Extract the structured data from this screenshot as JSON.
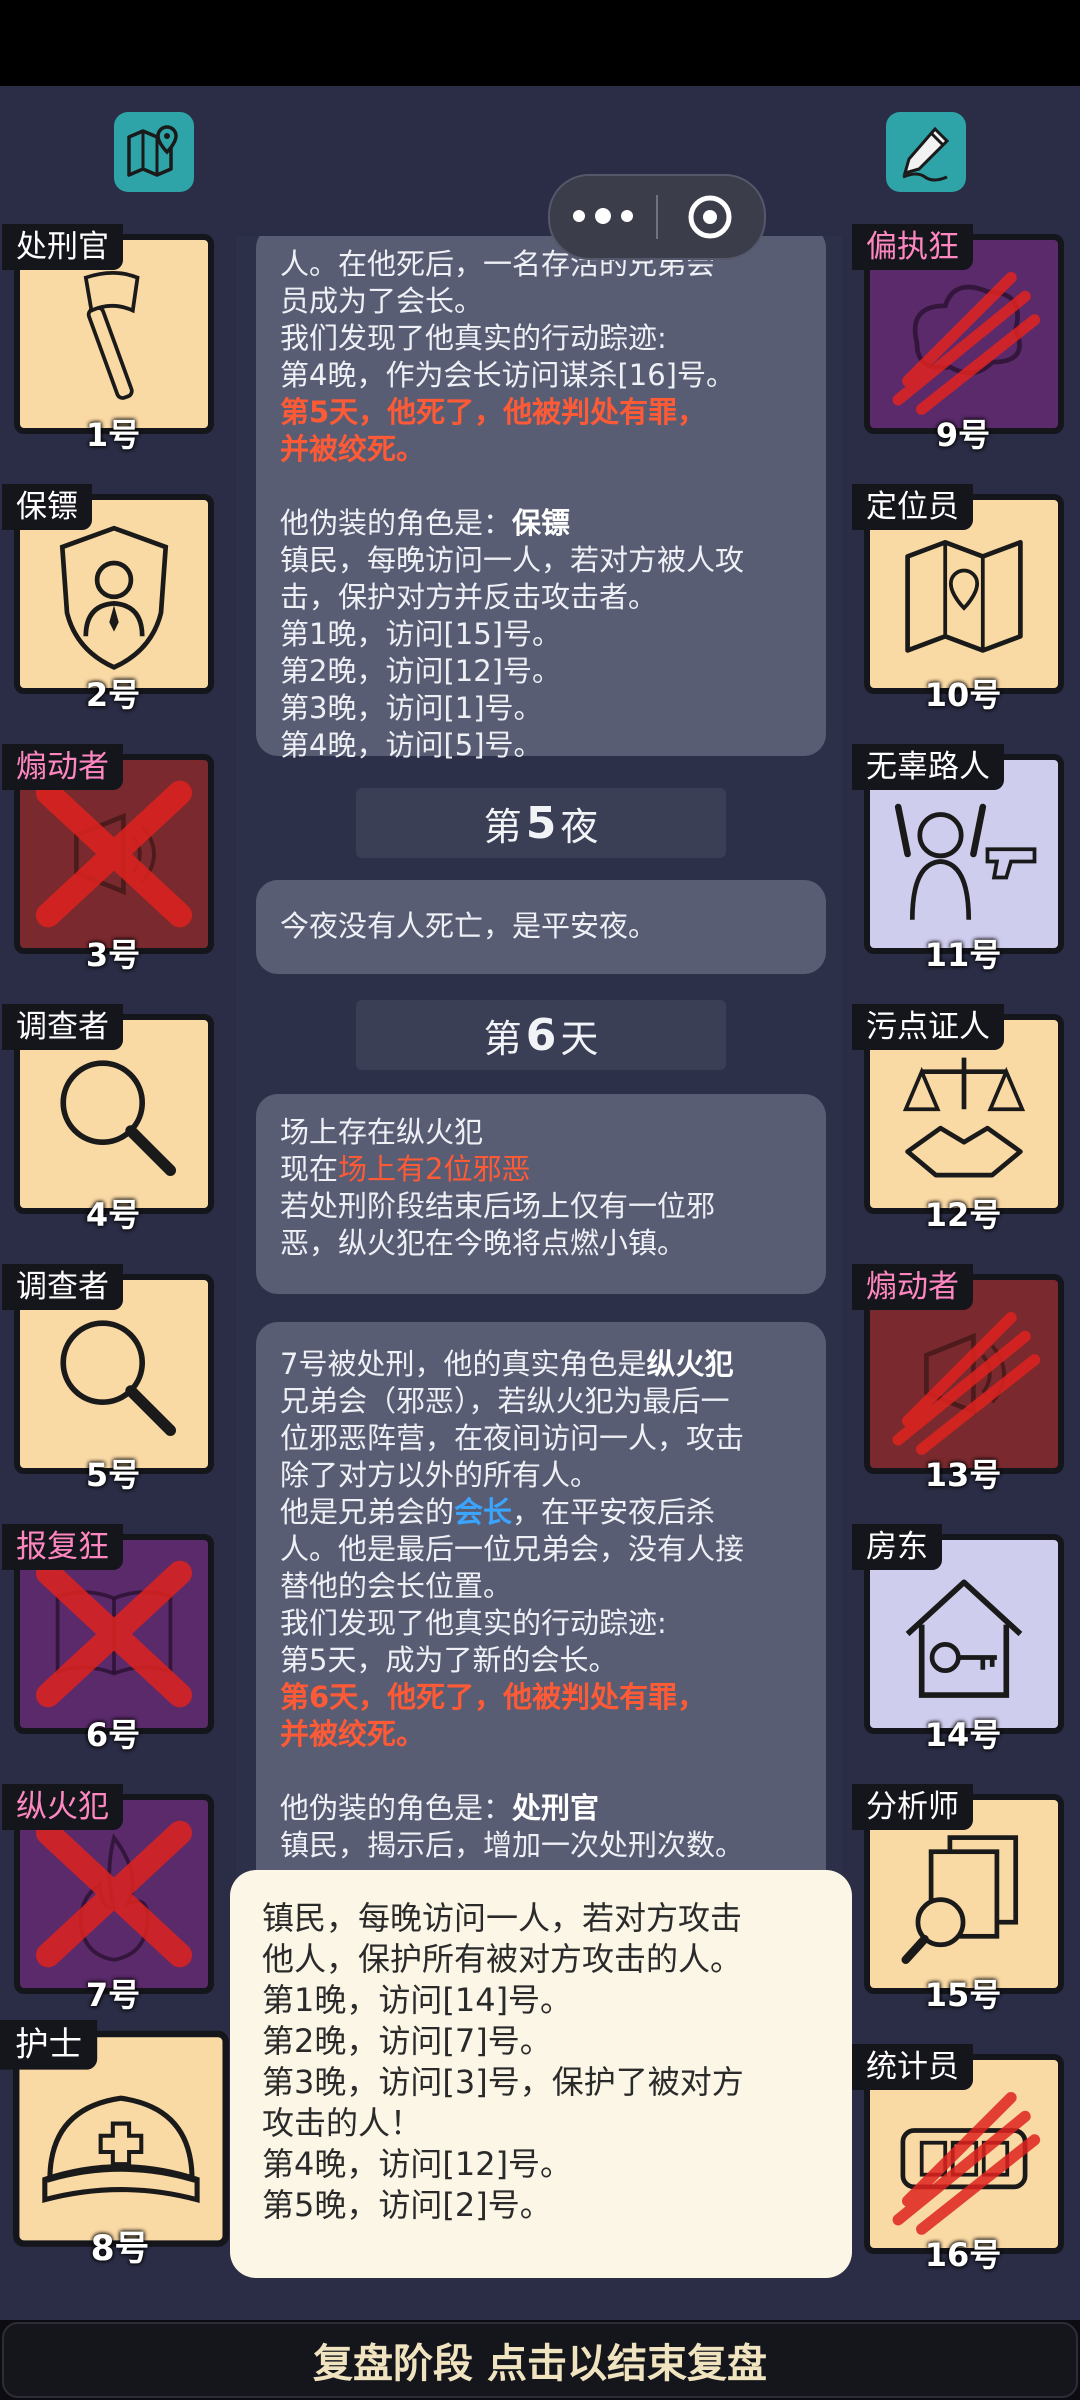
{
  "header": {
    "map_icon": "map-pin-icon",
    "edit_icon": "pen-edit-icon",
    "capsule_menu_icon": "more-dots-icon",
    "capsule_close_icon": "target-close-icon"
  },
  "left_players": [
    {
      "role": "处刑官",
      "number": "1号",
      "bg": "#f9d9a4",
      "icon": "axe-icon",
      "eliminated": false,
      "role_color": "white"
    },
    {
      "role": "保镖",
      "number": "2号",
      "bg": "#f9d9a4",
      "icon": "bodyguard-shield-icon",
      "eliminated": false,
      "role_color": "white"
    },
    {
      "role": "煽动者",
      "number": "3号",
      "bg": "#7a2a2e",
      "icon": "megaphone-icon",
      "eliminated": true,
      "role_color": "pink"
    },
    {
      "role": "调查者",
      "number": "4号",
      "bg": "#f9d9a4",
      "icon": "magnifier-icon",
      "eliminated": false,
      "role_color": "white"
    },
    {
      "role": "调查者",
      "number": "5号",
      "bg": "#f9d9a4",
      "icon": "magnifier-icon",
      "eliminated": false,
      "role_color": "white"
    },
    {
      "role": "报复狂",
      "number": "6号",
      "bg": "#5a2a6a",
      "icon": "book-icon",
      "eliminated": true,
      "role_color": "pink"
    },
    {
      "role": "纵火犯",
      "number": "7号",
      "bg": "#5a2a6a",
      "icon": "fire-icon",
      "eliminated": true,
      "role_color": "pink"
    },
    {
      "role": "护士",
      "number": "8号",
      "bg": "#f9d9a4",
      "icon": "nurse-cap-icon",
      "eliminated": false,
      "role_color": "white"
    }
  ],
  "right_players": [
    {
      "role": "偏执狂",
      "number": "9号",
      "bg": "#5a2a6a",
      "icon": "paranoid-cloud-icon",
      "eliminated": true,
      "role_color": "pink"
    },
    {
      "role": "定位员",
      "number": "10号",
      "bg": "#f9d9a4",
      "icon": "folded-map-icon",
      "eliminated": false,
      "role_color": "white"
    },
    {
      "role": "无辜路人",
      "number": "11号",
      "bg": "#cfcdee",
      "icon": "hands-up-gun-icon",
      "eliminated": false,
      "role_color": "white"
    },
    {
      "role": "污点证人",
      "number": "12号",
      "bg": "#f9d9a4",
      "icon": "scales-handshake-icon",
      "eliminated": false,
      "role_color": "white"
    },
    {
      "role": "煽动者",
      "number": "13号",
      "bg": "#7a2a2e",
      "icon": "megaphone-icon",
      "eliminated": true,
      "role_color": "pink"
    },
    {
      "role": "房东",
      "number": "14号",
      "bg": "#cfcdee",
      "icon": "house-key-icon",
      "eliminated": false,
      "role_color": "white"
    },
    {
      "role": "分析师",
      "number": "15号",
      "bg": "#f9d9a4",
      "icon": "documents-magnifier-icon",
      "eliminated": false,
      "role_color": "white"
    },
    {
      "role": "统计员",
      "number": "16号",
      "bg": "#f9d9a4",
      "icon": "counter-icon",
      "eliminated": true,
      "role_color": "white"
    }
  ],
  "feed": {
    "card1": {
      "line1": "人。在他死后，一名存活的兄弟会",
      "line2": "员成为了会长。",
      "line3": "我们发现了他真实的行动踪迹:",
      "line4": "第4晚，作为会长访问谋杀[16]号。",
      "line5": "第5天，他死了，他被判处有罪，",
      "line6": "并被绞死。",
      "line7_prefix": "他伪装的角色是：",
      "line7_role": "保镖",
      "line8": "镇民，每晚访问一人，若对方被人攻",
      "line9": "击，保护对方并反击攻击者。",
      "line10": "第1晚，访问[15]号。",
      "line11": "第2晚，访问[12]号。",
      "line12": "第3晚，访问[1]号。",
      "line13": "第4晚，访问[5]号。"
    },
    "banner1": {
      "prefix": "第",
      "num": "5",
      "suffix": "夜"
    },
    "card2": {
      "line1": "今夜没有人死亡，是平安夜。"
    },
    "banner2": {
      "prefix": "第",
      "num": "6",
      "suffix": "天"
    },
    "card3": {
      "line1": "场上存在纵火犯",
      "line2_prefix": "现在",
      "line2_red": "场上有2位邪恶",
      "line3": "若处刑阶段结束后场上仅有一位邪",
      "line4": "恶，纵火犯在今晚将点燃小镇。"
    },
    "card4": {
      "line1_prefix": "7号被处刑，他的真实角色是",
      "line1_role": "纵火犯",
      "line2": "兄弟会（邪恶），若纵火犯为最后一",
      "line3": "位邪恶阵营，在夜间访问一人，攻击",
      "line4": "除了对方以外的所有人。",
      "line5_prefix": "他是兄弟会的",
      "line5_blue": "会长",
      "line5_suffix": "，在平安夜后杀",
      "line6": "人。他是最后一位兄弟会，没有人接",
      "line7": "替他的会长位置。",
      "line8": "我们发现了他真实的行动踪迹:",
      "line9": "第5天，成为了新的会长。",
      "line10": "第6天，他死了，他被判处有罪，",
      "line11": "并被绞死。",
      "line12_prefix": "他伪装的角色是：",
      "line12_role": "处刑官",
      "line13": "镇民，揭示后，增加一次处刑次数。"
    }
  },
  "tooltip": {
    "line1": "镇民，每晚访问一人，若对方攻击",
    "line2": "他人，保护所有被对方攻击的人。",
    "line3": "第1晚，访问[14]号。",
    "line4": "第2晚，访问[7]号。",
    "line5": "第3晚，访问[3]号，保护了被对方",
    "line6": "攻击的人！",
    "line7": "第4晚，访问[12]号。",
    "line8": "第5晚，访问[2]号。"
  },
  "bottom_bar": {
    "label": "复盘阶段 点击以结束复盘"
  }
}
